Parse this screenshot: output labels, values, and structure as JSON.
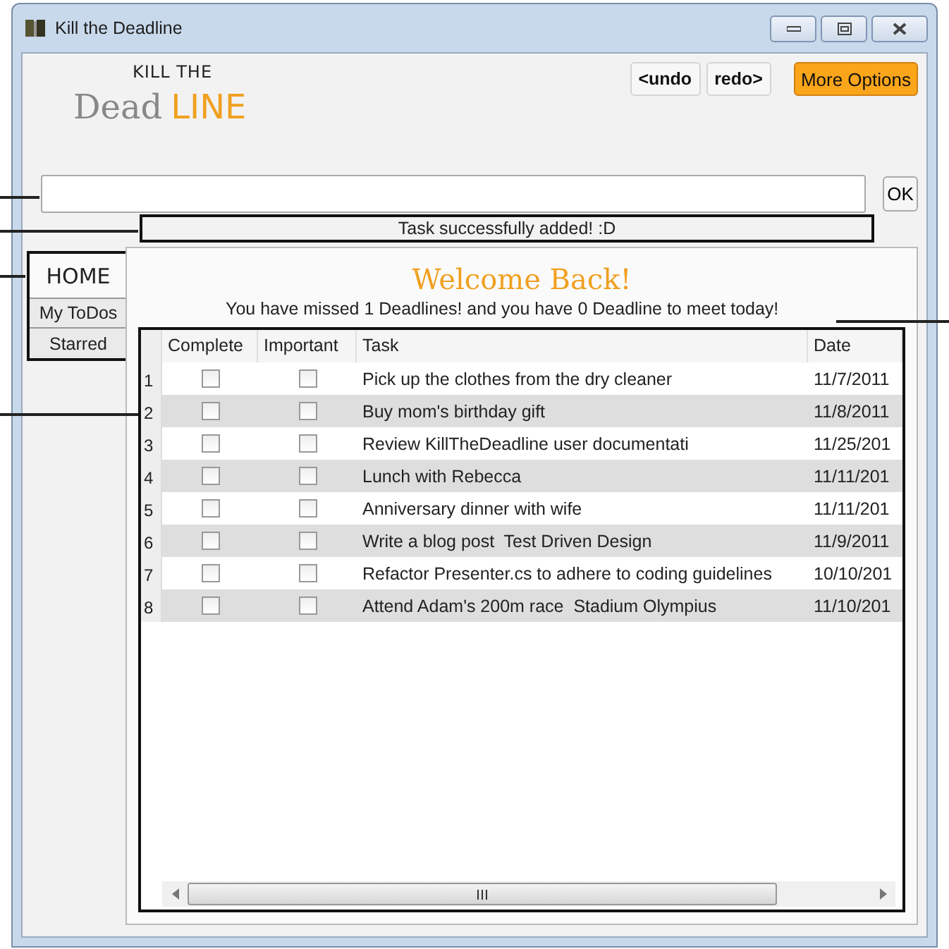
{
  "window": {
    "title": "Kill the Deadline"
  },
  "logo": {
    "line1": "KILL THE",
    "word1": "Dead",
    "word2": "LINE"
  },
  "toolbar": {
    "undo": "<undo",
    "redo": "redo>",
    "more": "More Options"
  },
  "command": {
    "ok": "OK"
  },
  "status": "Task successfully added! :D",
  "nav": [
    {
      "label": "HOME",
      "selected": true
    },
    {
      "label": "My ToDos",
      "selected": false
    },
    {
      "label": "Starred",
      "selected": false
    }
  ],
  "welcome": {
    "title": "Welcome Back!",
    "message": "You have missed 1 Deadlines! and you have 0 Deadline to meet today!"
  },
  "table": {
    "columns": [
      "Complete",
      "Important",
      "Task",
      "Date"
    ],
    "rows": [
      {
        "num": "1",
        "complete": false,
        "important": false,
        "task": "Pick up the clothes from the dry cleaner",
        "date": "11/7/2011"
      },
      {
        "num": "2",
        "complete": false,
        "important": false,
        "task": "Buy mom's birthday gift",
        "date": "11/8/2011"
      },
      {
        "num": "3",
        "complete": false,
        "important": false,
        "task": "Review KillTheDeadline user documentati",
        "date": "11/25/201"
      },
      {
        "num": "4",
        "complete": false,
        "important": false,
        "task": "Lunch with Rebecca",
        "date": "11/11/201"
      },
      {
        "num": "5",
        "complete": false,
        "important": false,
        "task": "Anniversary dinner with wife",
        "date": "11/11/201"
      },
      {
        "num": "6",
        "complete": false,
        "important": false,
        "task": "Write a blog post  Test Driven Design",
        "date": "11/9/2011"
      },
      {
        "num": "7",
        "complete": false,
        "important": false,
        "task": "Refactor Presenter.cs to adhere to coding guidelines",
        "date": "10/10/201"
      },
      {
        "num": "8",
        "complete": false,
        "important": false,
        "task": "Attend Adam's 200m race  Stadium Olympius",
        "date": "11/10/201"
      }
    ]
  }
}
